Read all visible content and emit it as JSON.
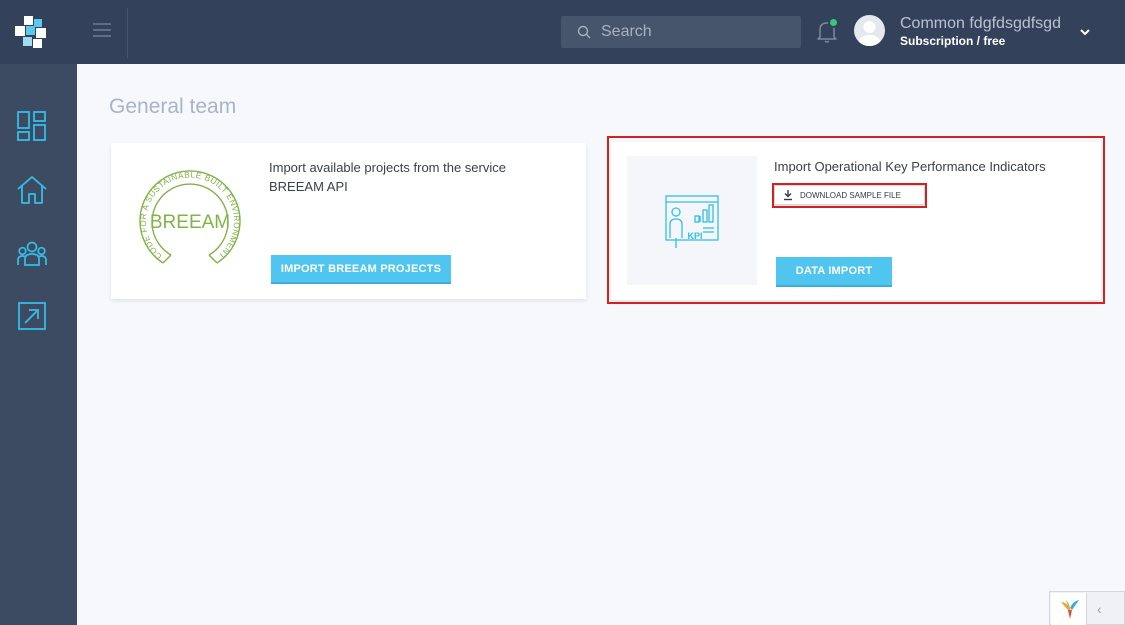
{
  "header": {
    "search": {
      "placeholder": "Search"
    },
    "user": {
      "name": "Common fdgfdsgdfsgd",
      "subscription": "Subscription / free"
    },
    "notification_dot_color": "#3cc77d"
  },
  "sidebar": {
    "items": [
      {
        "icon": "dashboard-icon"
      },
      {
        "icon": "home-icon"
      },
      {
        "icon": "team-icon"
      },
      {
        "icon": "export-icon"
      }
    ]
  },
  "page": {
    "title": "General team"
  },
  "cards": [
    {
      "logo": "breeam-logo",
      "logo_text": "BREEAM",
      "logo_ring_text": "CODE FOR A SUSTAINABLE BUILT ENVIRONMENT",
      "description_line1": "Import available projects from the service",
      "description_line2": "BREEAM API",
      "button_label": "IMPORT BREEAM PROJECTS"
    },
    {
      "logo": "kpi-icon",
      "logo_text": "KPI",
      "title": "Import Operational Key Performance Indicators",
      "download_label": "DOWNLOAD SAMPLE FILE",
      "button_label": "DATA IMPORT"
    }
  ],
  "colors": {
    "sidebar": "#3d4b62",
    "topbar": "#33415a",
    "accent": "#4fc5ef",
    "highlight": "#d32020"
  }
}
